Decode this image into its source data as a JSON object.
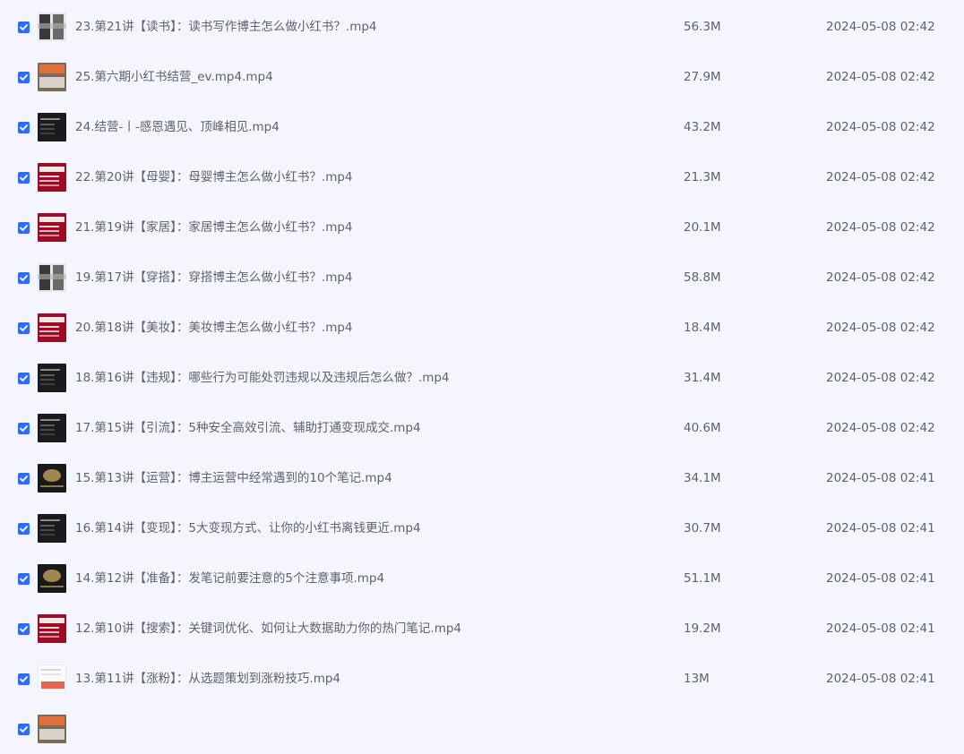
{
  "files": [
    {
      "name": "23.第21讲【读书】：读书写作博主怎么做小红书？.mp4",
      "size": "56.3M",
      "date": "2024-05-08 02:42",
      "checked": true,
      "thumb": "grid"
    },
    {
      "name": "25.第六期小红书结营_ev.mp4.mp4",
      "size": "27.9M",
      "date": "2024-05-08 02:42",
      "checked": true,
      "thumb": "warm"
    },
    {
      "name": "24.结营-丨-感恩遇见、顶峰相见.mp4",
      "size": "43.2M",
      "date": "2024-05-08 02:42",
      "checked": true,
      "thumb": "dark"
    },
    {
      "name": "22.第20讲【母婴】：母婴博主怎么做小红书？.mp4",
      "size": "21.3M",
      "date": "2024-05-08 02:42",
      "checked": true,
      "thumb": "red"
    },
    {
      "name": "21.第19讲【家居】：家居博主怎么做小红书？.mp4",
      "size": "20.1M",
      "date": "2024-05-08 02:42",
      "checked": true,
      "thumb": "red"
    },
    {
      "name": "19.第17讲【穿搭】：穿搭博主怎么做小红书？.mp4",
      "size": "58.8M",
      "date": "2024-05-08 02:42",
      "checked": true,
      "thumb": "grid"
    },
    {
      "name": "20.第18讲【美妆】：美妆博主怎么做小红书？.mp4",
      "size": "18.4M",
      "date": "2024-05-08 02:42",
      "checked": true,
      "thumb": "red"
    },
    {
      "name": "18.第16讲【违规】：哪些行为可能处罚违规以及违规后怎么做？.mp4",
      "size": "31.4M",
      "date": "2024-05-08 02:42",
      "checked": true,
      "thumb": "dark"
    },
    {
      "name": "17.第15讲【引流】：5种安全高效引流、辅助打通变现成交.mp4",
      "size": "40.6M",
      "date": "2024-05-08 02:42",
      "checked": true,
      "thumb": "dark"
    },
    {
      "name": "15.第13讲【运营】：博主运营中经常遇到的10个笔记.mp4",
      "size": "34.1M",
      "date": "2024-05-08 02:41",
      "checked": true,
      "thumb": "gold"
    },
    {
      "name": "16.第14讲【变现】：5大变现方式、让你的小红书离钱更近.mp4",
      "size": "30.7M",
      "date": "2024-05-08 02:41",
      "checked": true,
      "thumb": "dark"
    },
    {
      "name": "14.第12讲【准备】：发笔记前要注意的5个注意事项.mp4",
      "size": "51.1M",
      "date": "2024-05-08 02:41",
      "checked": true,
      "thumb": "gold"
    },
    {
      "name": "12.第10讲【搜索】：关键词优化、如何让大数据助力你的热门笔记.mp4",
      "size": "19.2M",
      "date": "2024-05-08 02:41",
      "checked": true,
      "thumb": "red"
    },
    {
      "name": "13.第11讲【涨粉】：从选题策划到涨粉技巧.mp4",
      "size": "13M",
      "date": "2024-05-08 02:41",
      "checked": true,
      "thumb": "light"
    },
    {
      "name": "",
      "size": "",
      "date": "",
      "checked": true,
      "thumb": "warm"
    }
  ]
}
